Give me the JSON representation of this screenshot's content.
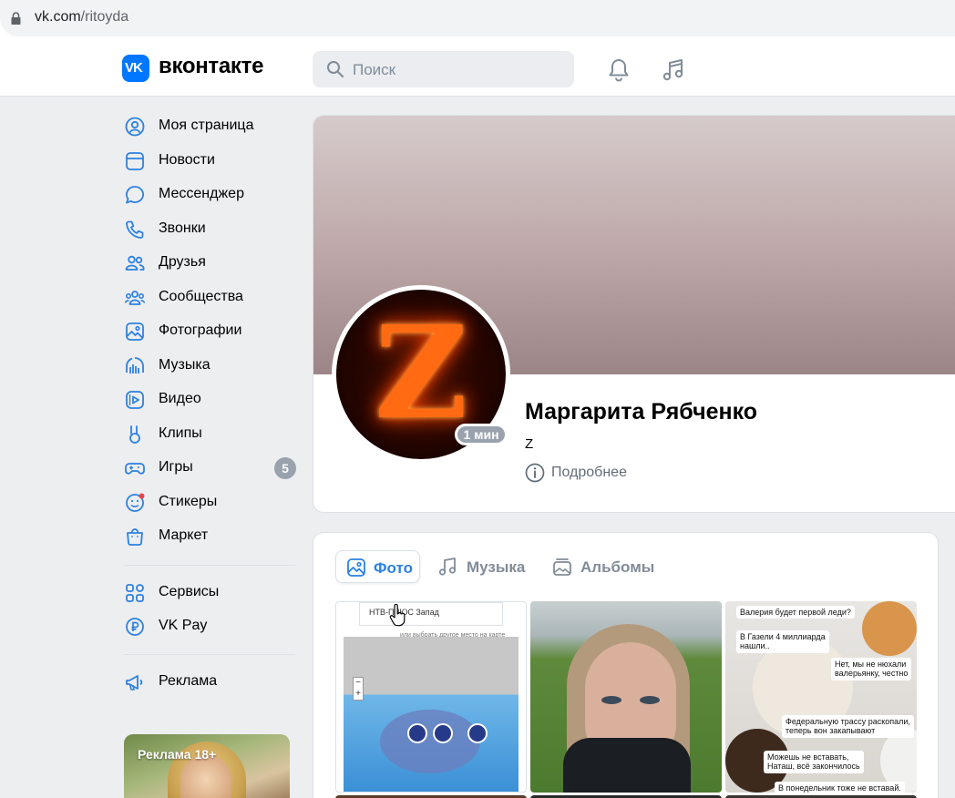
{
  "browser": {
    "url_host": "vk.com",
    "url_path": "/ritoyda"
  },
  "header": {
    "logo_text": "VK",
    "brand": "вконтакте",
    "search_placeholder": "Поиск"
  },
  "sidebar": {
    "items": [
      {
        "label": "Моя страница",
        "icon": "user-circle-icon"
      },
      {
        "label": "Новости",
        "icon": "news-icon"
      },
      {
        "label": "Мессенджер",
        "icon": "message-icon"
      },
      {
        "label": "Звонки",
        "icon": "phone-icon"
      },
      {
        "label": "Друзья",
        "icon": "friends-icon"
      },
      {
        "label": "Сообщества",
        "icon": "communities-icon"
      },
      {
        "label": "Фотографии",
        "icon": "photo-icon"
      },
      {
        "label": "Музыка",
        "icon": "music-icon"
      },
      {
        "label": "Видео",
        "icon": "video-icon"
      },
      {
        "label": "Клипы",
        "icon": "clips-icon"
      },
      {
        "label": "Игры",
        "icon": "gamepad-icon",
        "badge": "5"
      },
      {
        "label": "Стикеры",
        "icon": "sticker-icon"
      },
      {
        "label": "Маркет",
        "icon": "market-icon"
      }
    ],
    "extra_items": [
      {
        "label": "Сервисы",
        "icon": "services-icon"
      },
      {
        "label": "VK Pay",
        "icon": "vkpay-icon"
      }
    ],
    "ads_item": {
      "label": "Реклама",
      "icon": "megaphone-icon"
    },
    "ad_card_label": "Реклама 18+"
  },
  "profile": {
    "name": "Маргарита Рябченко",
    "status": "Z",
    "online": "1 мин",
    "more_label": "Подробнее",
    "avatar_letter": "Z"
  },
  "media": {
    "tabs": [
      {
        "label": "Фото",
        "active": true
      },
      {
        "label": "Музыка",
        "active": false
      },
      {
        "label": "Альбомы",
        "active": false
      }
    ],
    "photo1": {
      "select_text": "НТВ-ПЛЮС Запад",
      "hint": "или выбрать другое место на карте"
    },
    "photo3": {
      "captions": [
        "Валерия будет первой леди?",
        "В Газели 4 миллиарда\nнашли..",
        "Нет, мы не нюхали\nвалерьянку, честно",
        "Федеральную трассу раскопали,\nтеперь вон закапывают",
        "Можешь не вставать,\nНаташ, всё закончилось",
        "В понедельник тоже не вставай."
      ]
    }
  },
  "colors": {
    "accent": "#2d81e0",
    "vk_blue": "#0077ff",
    "badge": "#99a2ad"
  }
}
